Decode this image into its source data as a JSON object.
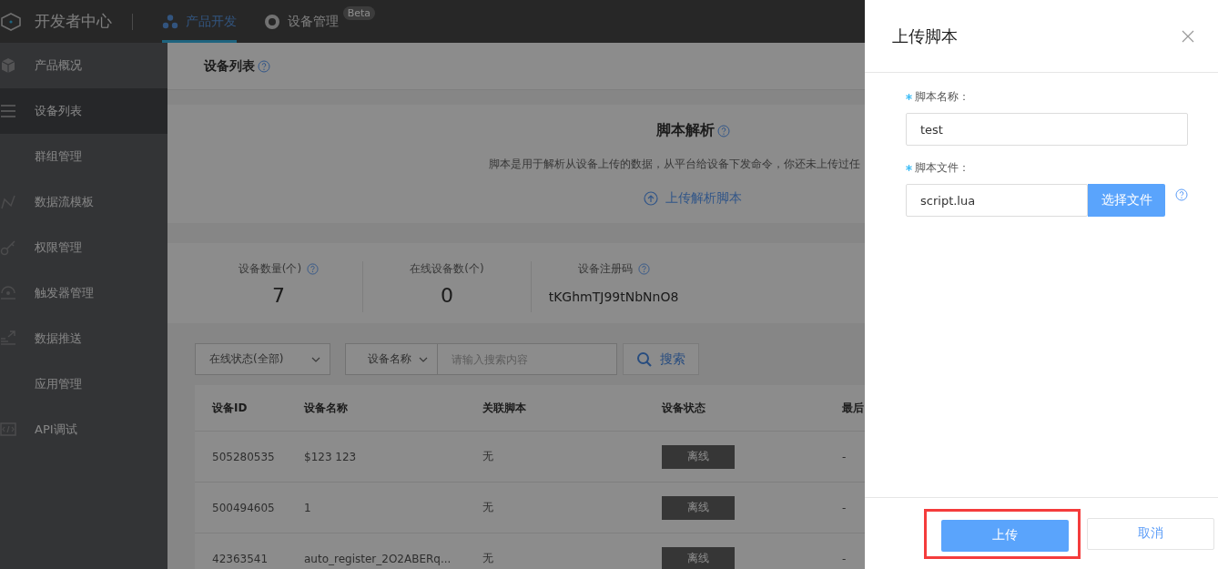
{
  "topbar": {
    "logo_text": "开发者中心",
    "tabs": [
      {
        "label": "产品开发",
        "selected": true
      },
      {
        "label": "设备管理",
        "selected": false,
        "badge": "Beta"
      }
    ]
  },
  "sidebar": {
    "items": [
      {
        "label": "产品概况",
        "selected": false
      },
      {
        "label": "设备列表",
        "selected": true
      },
      {
        "label": "群组管理",
        "selected": false
      },
      {
        "label": "数据流模板",
        "selected": false
      },
      {
        "label": "权限管理",
        "selected": false
      },
      {
        "label": "触发器管理",
        "selected": false
      },
      {
        "label": "数据推送",
        "selected": false
      },
      {
        "label": "应用管理",
        "selected": false
      },
      {
        "label": "API调试",
        "selected": false
      }
    ]
  },
  "page_title": "设备列表",
  "script_panel": {
    "title": "脚本解析",
    "description": "脚本是用于解析从设备上传的数据，从平台给设备下发命令，你还未上传过任",
    "upload_link": "上传解析脚本"
  },
  "stats": [
    {
      "label": "设备数量(个)",
      "value": "7",
      "help": true
    },
    {
      "label": "在线设备数(个)",
      "value": "0",
      "help": false
    },
    {
      "label": "设备注册码",
      "value": "tKGhmTJ99tNbNnO8",
      "help": true
    }
  ],
  "filters": {
    "status_select": "在线状态(全部)",
    "field_select": "设备名称",
    "search_placeholder": "请输入搜索内容",
    "search_button": "搜索"
  },
  "table": {
    "columns": [
      "设备ID",
      "设备名称",
      "关联脚本",
      "设备状态",
      "最后"
    ],
    "rows": [
      {
        "id": "505280535",
        "name": "$123 123",
        "script": "无",
        "status": "离线",
        "last": "-"
      },
      {
        "id": "500494605",
        "name": "1",
        "script": "无",
        "status": "离线",
        "last": "-"
      },
      {
        "id": "42363541",
        "name": "auto_register_2O2ABERq...",
        "script": "无",
        "status": "离线",
        "last": "-"
      }
    ]
  },
  "drawer": {
    "title": "上传脚本",
    "fields": [
      {
        "kind": "text",
        "label": "脚本名称：",
        "required": true,
        "value": "test"
      },
      {
        "kind": "file",
        "label": "脚本文件：",
        "required": true,
        "value": "script.lua",
        "button": "选择文件"
      }
    ],
    "buttons": [
      {
        "label": "上传",
        "primary": true,
        "highlighted": true
      },
      {
        "label": "取消",
        "primary": false,
        "highlighted": false
      }
    ]
  }
}
